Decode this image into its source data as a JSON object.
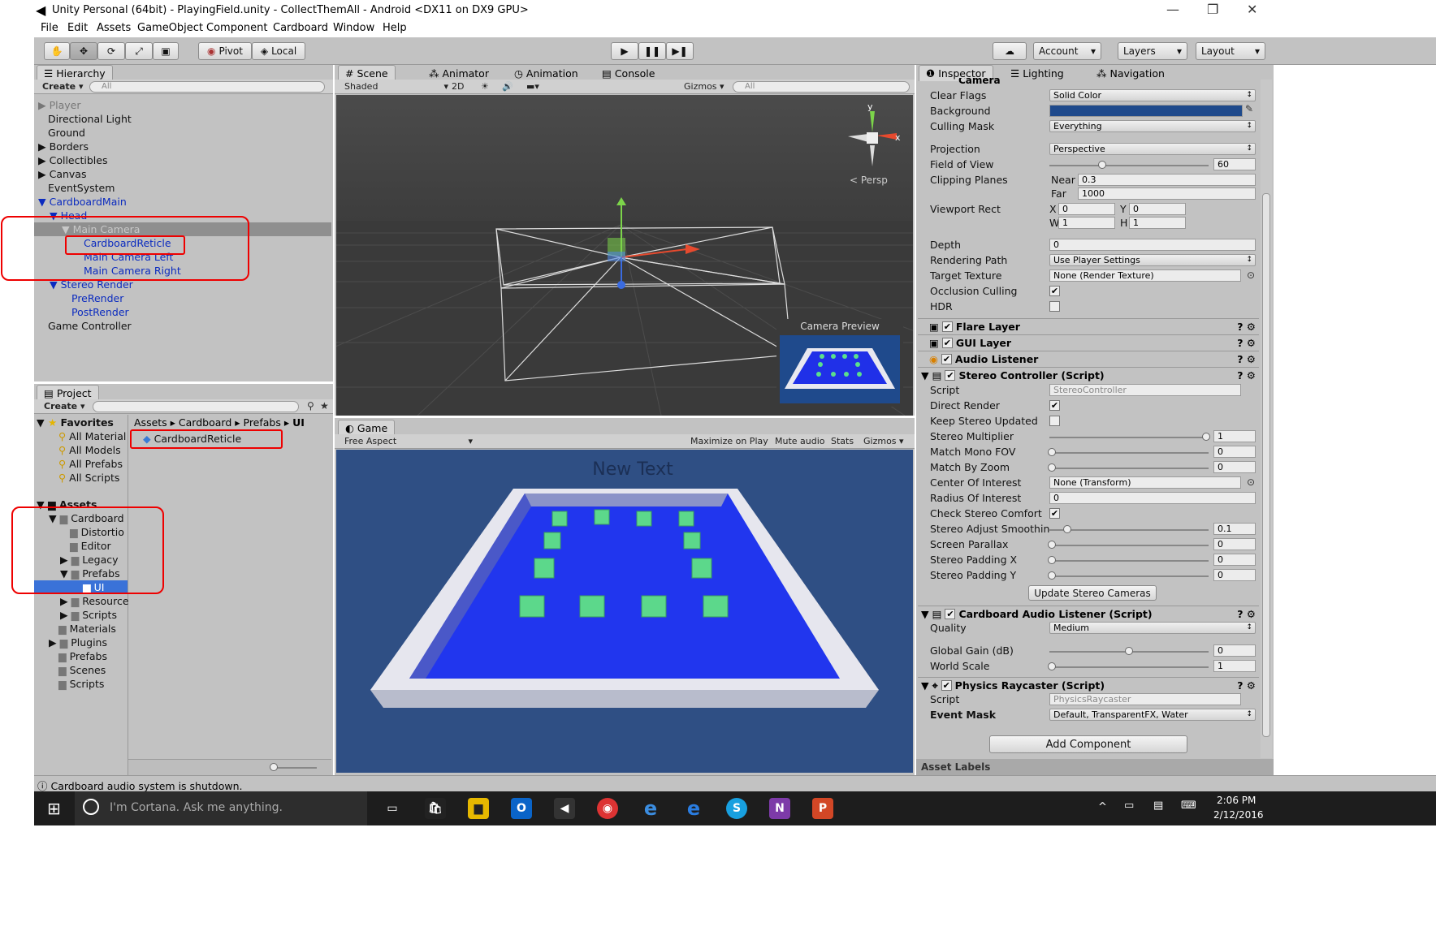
{
  "window": {
    "title": "Unity Personal (64bit) - PlayingField.unity - CollectThemAll - Android <DX11 on DX9 GPU>"
  },
  "menu": [
    "File",
    "Edit",
    "Assets",
    "GameObject",
    "Component",
    "Cardboard",
    "Window",
    "Help"
  ],
  "toolbar": {
    "pivot": "Pivot",
    "local": "Local",
    "account": "Account",
    "layers": "Layers",
    "layout": "Layout"
  },
  "hierarchy": {
    "tab": "Hierarchy",
    "create": "Create",
    "search": "All",
    "items": [
      "Player",
      "Directional Light",
      "Ground",
      "Borders",
      "Collectibles",
      "Canvas",
      "EventSystem",
      "CardboardMain",
      "Head",
      "Main Camera",
      "CardboardReticle",
      "Main Camera Left",
      "Main Camera Right",
      "Stereo Render",
      "PreRender",
      "PostRender",
      "Game Controller"
    ]
  },
  "scene": {
    "tabs": [
      "Scene",
      "Animator",
      "Animation",
      "Console"
    ],
    "shaded": "Shaded",
    "mode2d": "2D",
    "gizmos": "Gizmos",
    "search": "All",
    "persp": "Persp",
    "axis_y": "y",
    "axis_x": "x",
    "camera_preview": "Camera Preview"
  },
  "project": {
    "tab": "Project",
    "create": "Create",
    "favorites_label": "Favorites",
    "favorites": [
      "All Material",
      "All Models",
      "All Prefabs",
      "All Scripts"
    ],
    "assets_label": "Assets",
    "tree": [
      "Cardboard",
      "Distortio",
      "Editor",
      "Legacy",
      "Prefabs",
      "UI",
      "Resource",
      "Scripts",
      "Materials",
      "Plugins",
      "Prefabs",
      "Scenes",
      "Scripts"
    ],
    "breadcrumb": [
      "Assets",
      "Cardboard",
      "Prefabs",
      "UI"
    ],
    "file": "CardboardReticle"
  },
  "game": {
    "tab": "Game",
    "aspect": "Free Aspect",
    "buttons": [
      "Maximize on Play",
      "Mute audio",
      "Stats",
      "Gizmos"
    ],
    "overlay_text": "New Text"
  },
  "inspector": {
    "tabs": [
      "Inspector",
      "Lighting",
      "Navigation"
    ],
    "camera_title": "Camera",
    "camera": {
      "clear_flags": [
        "Clear Flags",
        "Solid Color"
      ],
      "background": "Background",
      "background_color": "#1f4a8c",
      "culling_mask": [
        "Culling Mask",
        "Everything"
      ],
      "projection": [
        "Projection",
        "Perspective"
      ],
      "fov": [
        "Field of View",
        "60"
      ],
      "fov_value": 0.27,
      "clipping": "Clipping Planes",
      "near": [
        "Near",
        "0.3"
      ],
      "far": [
        "Far",
        "1000"
      ],
      "viewport": "Viewport Rect",
      "vx": [
        "X",
        "0"
      ],
      "vy": [
        "Y",
        "0"
      ],
      "vw": [
        "W",
        "1"
      ],
      "vh": [
        "H",
        "1"
      ],
      "depth": [
        "Depth",
        "0"
      ],
      "rendering_path": [
        "Rendering Path",
        "Use Player Settings"
      ],
      "target_texture": [
        "Target Texture",
        "None (Render Texture)"
      ],
      "occlusion": "Occlusion Culling",
      "hdr": "HDR"
    },
    "flare": "Flare Layer",
    "gui": "GUI Layer",
    "audio": "Audio Listener",
    "stereo_title": "Stereo Controller (Script)",
    "stereo": {
      "script": [
        "Script",
        "StereoController"
      ],
      "direct_render": "Direct Render",
      "keep_updated": "Keep Stereo Updated",
      "multiplier": [
        "Stereo Multiplier",
        "1"
      ],
      "mono_fov": [
        "Match Mono FOV",
        "0"
      ],
      "match_zoom": [
        "Match By Zoom",
        "0"
      ],
      "center": [
        "Center Of Interest",
        "None (Transform)"
      ],
      "radius": [
        "Radius Of Interest",
        "0"
      ],
      "check_comfort": "Check Stereo Comfort",
      "smoothing": [
        "Stereo Adjust Smoothin",
        "0.1"
      ],
      "parallax": [
        "Screen Parallax",
        "0"
      ],
      "padx": [
        "Stereo Padding X",
        "0"
      ],
      "pady": [
        "Stereo Padding Y",
        "0"
      ],
      "update_btn": "Update Stereo Cameras"
    },
    "cal_title": "Cardboard Audio Listener (Script)",
    "cal": {
      "quality": [
        "Quality",
        "Medium"
      ],
      "gain": [
        "Global Gain (dB)",
        "0"
      ],
      "scale": [
        "World Scale",
        "1"
      ]
    },
    "pr_title": "Physics Raycaster (Script)",
    "pr": {
      "script": [
        "Script",
        "PhysicsRaycaster"
      ],
      "mask": [
        "Event Mask",
        "Default, TransparentFX, Water"
      ]
    },
    "add_component": "Add Component",
    "asset_labels": "Asset Labels"
  },
  "status": "Cardboard audio system is shutdown.",
  "taskbar": {
    "cortana": "I'm Cortana. Ask me anything.",
    "time": "2:06 PM",
    "date": "2/12/2016"
  }
}
